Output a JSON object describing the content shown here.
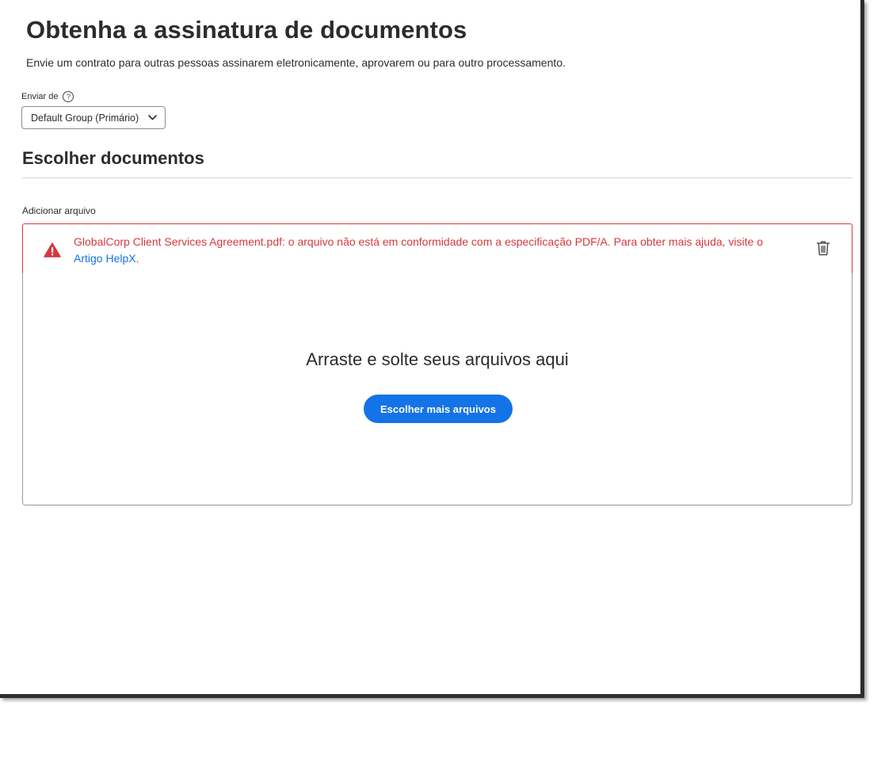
{
  "header": {
    "title": "Obtenha a assinatura de documentos",
    "subtitle": "Envie um contrato para outras pessoas assinarem eletronicamente, aprovarem ou para outro processamento."
  },
  "send_from": {
    "label": "Enviar de",
    "help_icon": "question-circle-icon",
    "help_glyph": "?",
    "selected_value": "Default Group (Primário)"
  },
  "documents_section": {
    "title": "Escolher documentos",
    "add_file_label": "Adicionar arquivo"
  },
  "error_banner": {
    "message": "GlobalCorp Client Services Agreement.pdf: o arquivo não está em conformidade com a especificação PDF/A. Para obter mais ajuda, visite o",
    "link_text": "Artigo HelpX",
    "trailing_text": ".",
    "icon": "warning-triangle-icon",
    "delete_icon": "trash-icon",
    "color": "#d7373f"
  },
  "drop_zone": {
    "title": "Arraste e solte seus arquivos aqui",
    "button_label": "Escolher mais arquivos"
  },
  "colors": {
    "accent": "#1473e6",
    "error": "#d7373f",
    "text": "#2c2c2c"
  }
}
